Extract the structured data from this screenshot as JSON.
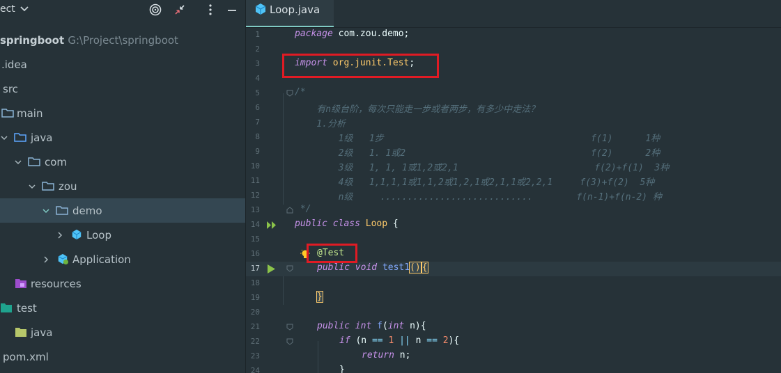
{
  "project_panel": {
    "title": "ect",
    "tree": [
      {
        "label": "springboot",
        "path": "G:\\Project\\springboot",
        "type": "module"
      },
      {
        "label": ".idea",
        "type": "folder"
      },
      {
        "label": "src",
        "type": "folder"
      },
      {
        "label": "main",
        "type": "folder"
      },
      {
        "label": "java",
        "type": "source-folder"
      },
      {
        "label": "com",
        "type": "package"
      },
      {
        "label": "zou",
        "type": "package"
      },
      {
        "label": "demo",
        "type": "package",
        "selected": true
      },
      {
        "label": "Loop",
        "type": "java-class"
      },
      {
        "label": "Application",
        "type": "spring-class"
      },
      {
        "label": "resources",
        "type": "resources-folder"
      },
      {
        "label": "test",
        "type": "test-folder"
      },
      {
        "label": "java",
        "type": "test-source-folder"
      },
      {
        "label": "pom.xml",
        "type": "file"
      }
    ]
  },
  "editor": {
    "tab": {
      "label": "Loop.java"
    },
    "current_line": 17,
    "lines": [
      {
        "n": "1"
      },
      {
        "n": "2"
      },
      {
        "n": "3"
      },
      {
        "n": "4"
      },
      {
        "n": "5"
      },
      {
        "n": "6"
      },
      {
        "n": "7"
      },
      {
        "n": "8"
      },
      {
        "n": "9"
      },
      {
        "n": "10"
      },
      {
        "n": "11"
      },
      {
        "n": "12"
      },
      {
        "n": "13"
      },
      {
        "n": "14"
      },
      {
        "n": "15"
      },
      {
        "n": "16"
      },
      {
        "n": "17"
      },
      {
        "n": "18"
      },
      {
        "n": "19"
      },
      {
        "n": "20"
      },
      {
        "n": "21"
      },
      {
        "n": "22"
      },
      {
        "n": "23"
      },
      {
        "n": "24"
      }
    ],
    "code": {
      "l1_kw": "package",
      "l1_rest": " com.zou.demo;",
      "l3_kw": "import",
      "l3_pkg": " org.junit.",
      "l3_cls": "Test",
      "l3_end": ";",
      "l5": "/*",
      "l6": "    有n级台阶，每次只能走一步或者两步，有多少中走法？",
      "l7": "    1.分析",
      "l8": "        1级   1步                                      f(1)      1种",
      "l9": "        2级   1. 1或2                                  f(2)      2种",
      "l10": "        3级   1, 1, 1或1,2或2,1                         f(2)+f(1)  3种",
      "l11": "        4级   1,1,1,1或1,1,2或1,2,1或2,1,1或2,2,1     f(3)+f(2)  5种",
      "l12": "        n级     ............................        f(n-1)+f(n-2) 种",
      "l13": " */",
      "l14_kw1": "public",
      "l14_kw2": "class",
      "l14_cls": "Loop",
      "l14_end": " {",
      "l16_ann": "@Test",
      "l17_kw1": "public",
      "l17_kw2": "void",
      "l17_fn": "test1",
      "l17_paren": "()",
      "l17_brace": "{",
      "l19": "}",
      "l21_kw1": "public",
      "l21_type": "int",
      "l21_fn": "f",
      "l21_p1": "(",
      "l21_type2": "int",
      "l21_rest": " n){",
      "l22_kw": "if",
      "l22_a": " (n ",
      "l22_op1": "==",
      "l22_n1": "1",
      "l22_op2": "||",
      "l22_b": " n ",
      "l22_op3": "==",
      "l22_n2": "2",
      "l22_end": "){",
      "l23_kw": "return",
      "l23_rest": " n;",
      "l24": "}"
    }
  },
  "colors": {
    "background": "#263238",
    "selection": "#344752",
    "accent": "#80cbc4",
    "highlight_box": "#e01b24"
  }
}
